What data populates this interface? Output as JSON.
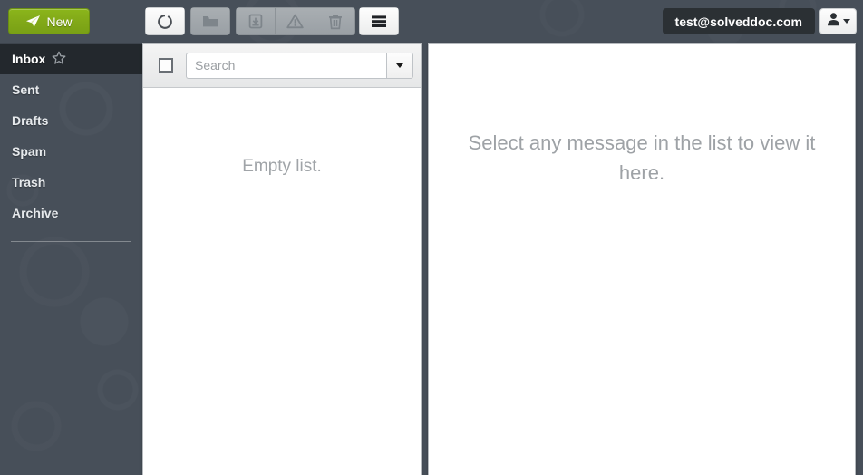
{
  "topbar": {
    "new_button": {
      "label": "New",
      "icon": "paper-plane-icon",
      "color": "#82a918"
    },
    "toolbar_buttons": [
      {
        "name": "refresh-button",
        "icon": "refresh-circle-icon",
        "state": "enabled"
      },
      {
        "name": "move-to-folder-button",
        "icon": "folder-icon",
        "state": "disabled"
      },
      {
        "name": "archive-button",
        "icon": "archive-box-icon",
        "state": "disabled"
      },
      {
        "name": "mark-spam-button",
        "icon": "warning-triangle-icon",
        "state": "disabled"
      },
      {
        "name": "delete-button",
        "icon": "trash-icon",
        "state": "disabled"
      },
      {
        "name": "options-menu-button",
        "icon": "hamburger-menu-icon",
        "state": "enabled"
      }
    ],
    "account": {
      "email": "test@solveddoc.com",
      "badge_color": "#2b3034"
    },
    "user_menu": {
      "icon": "user-icon",
      "caret": "chevron-down-icon"
    }
  },
  "sidebar": {
    "background_color": "#474f59",
    "selected_color": "#23282d",
    "items": [
      {
        "label": "Inbox",
        "selected": true,
        "badge_icon": "star-icon"
      },
      {
        "label": "Sent",
        "selected": false,
        "badge_icon": ""
      },
      {
        "label": "Drafts",
        "selected": false,
        "badge_icon": ""
      },
      {
        "label": "Spam",
        "selected": false,
        "badge_icon": ""
      },
      {
        "label": "Trash",
        "selected": false,
        "badge_icon": ""
      },
      {
        "label": "Archive",
        "selected": false,
        "badge_icon": ""
      }
    ]
  },
  "message_list": {
    "select_all_checked": false,
    "search": {
      "value": "",
      "placeholder": "Search"
    },
    "search_dropdown_icon": "chevron-down-icon",
    "empty_text": "Empty list."
  },
  "preview": {
    "placeholder_text": "Select any message in the list to view it here."
  }
}
